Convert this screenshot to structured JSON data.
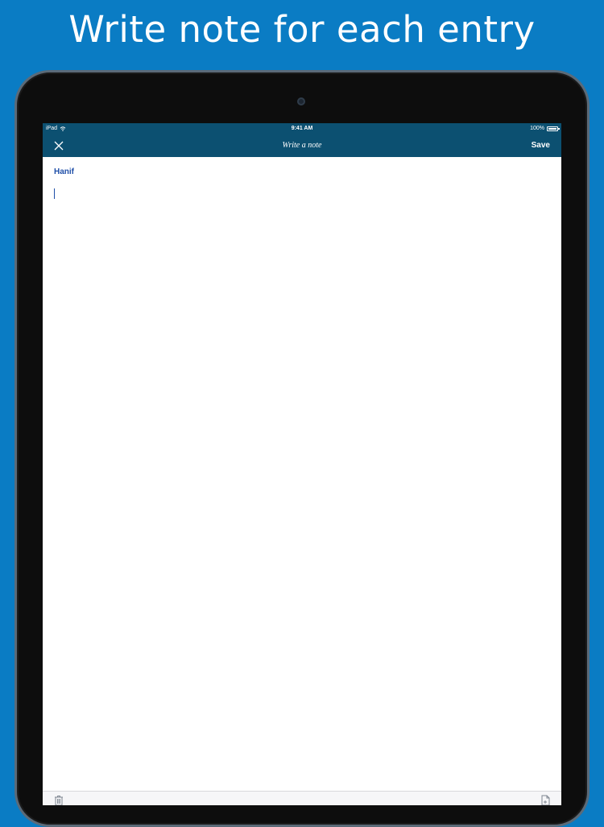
{
  "promo": {
    "headline": "Write note for each entry"
  },
  "status_bar": {
    "carrier": "iPad",
    "time": "9:41 AM",
    "battery": "100%"
  },
  "nav": {
    "title": "Write a note",
    "save_label": "Save",
    "close_icon": "close-icon"
  },
  "note": {
    "author": "Hanif",
    "body": "",
    "placeholder": ""
  },
  "toolbar": {
    "left_icon": "trash-icon",
    "right_icon": "document-icon"
  },
  "colors": {
    "background": "#0a7cc4",
    "nav_bar": "#0c5071",
    "author_text": "#1f4fa8"
  }
}
